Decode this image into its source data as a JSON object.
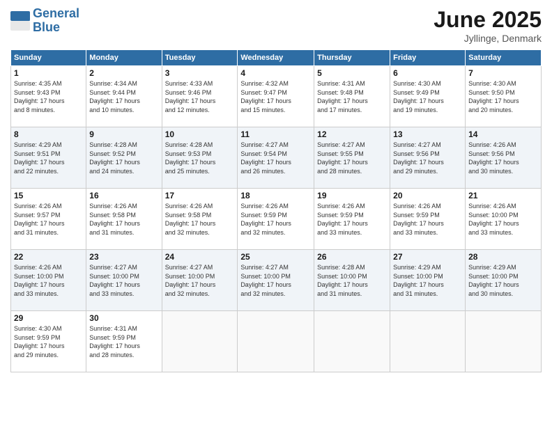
{
  "logo": {
    "line1": "General",
    "line2": "Blue"
  },
  "title": "June 2025",
  "subtitle": "Jyllinge, Denmark",
  "days_of_week": [
    "Sunday",
    "Monday",
    "Tuesday",
    "Wednesday",
    "Thursday",
    "Friday",
    "Saturday"
  ],
  "weeks": [
    [
      {
        "day": "1",
        "info": "Sunrise: 4:35 AM\nSunset: 9:43 PM\nDaylight: 17 hours\nand 8 minutes."
      },
      {
        "day": "2",
        "info": "Sunrise: 4:34 AM\nSunset: 9:44 PM\nDaylight: 17 hours\nand 10 minutes."
      },
      {
        "day": "3",
        "info": "Sunrise: 4:33 AM\nSunset: 9:46 PM\nDaylight: 17 hours\nand 12 minutes."
      },
      {
        "day": "4",
        "info": "Sunrise: 4:32 AM\nSunset: 9:47 PM\nDaylight: 17 hours\nand 15 minutes."
      },
      {
        "day": "5",
        "info": "Sunrise: 4:31 AM\nSunset: 9:48 PM\nDaylight: 17 hours\nand 17 minutes."
      },
      {
        "day": "6",
        "info": "Sunrise: 4:30 AM\nSunset: 9:49 PM\nDaylight: 17 hours\nand 19 minutes."
      },
      {
        "day": "7",
        "info": "Sunrise: 4:30 AM\nSunset: 9:50 PM\nDaylight: 17 hours\nand 20 minutes."
      }
    ],
    [
      {
        "day": "8",
        "info": "Sunrise: 4:29 AM\nSunset: 9:51 PM\nDaylight: 17 hours\nand 22 minutes."
      },
      {
        "day": "9",
        "info": "Sunrise: 4:28 AM\nSunset: 9:52 PM\nDaylight: 17 hours\nand 24 minutes."
      },
      {
        "day": "10",
        "info": "Sunrise: 4:28 AM\nSunset: 9:53 PM\nDaylight: 17 hours\nand 25 minutes."
      },
      {
        "day": "11",
        "info": "Sunrise: 4:27 AM\nSunset: 9:54 PM\nDaylight: 17 hours\nand 26 minutes."
      },
      {
        "day": "12",
        "info": "Sunrise: 4:27 AM\nSunset: 9:55 PM\nDaylight: 17 hours\nand 28 minutes."
      },
      {
        "day": "13",
        "info": "Sunrise: 4:27 AM\nSunset: 9:56 PM\nDaylight: 17 hours\nand 29 minutes."
      },
      {
        "day": "14",
        "info": "Sunrise: 4:26 AM\nSunset: 9:56 PM\nDaylight: 17 hours\nand 30 minutes."
      }
    ],
    [
      {
        "day": "15",
        "info": "Sunrise: 4:26 AM\nSunset: 9:57 PM\nDaylight: 17 hours\nand 31 minutes."
      },
      {
        "day": "16",
        "info": "Sunrise: 4:26 AM\nSunset: 9:58 PM\nDaylight: 17 hours\nand 31 minutes."
      },
      {
        "day": "17",
        "info": "Sunrise: 4:26 AM\nSunset: 9:58 PM\nDaylight: 17 hours\nand 32 minutes."
      },
      {
        "day": "18",
        "info": "Sunrise: 4:26 AM\nSunset: 9:59 PM\nDaylight: 17 hours\nand 32 minutes."
      },
      {
        "day": "19",
        "info": "Sunrise: 4:26 AM\nSunset: 9:59 PM\nDaylight: 17 hours\nand 33 minutes."
      },
      {
        "day": "20",
        "info": "Sunrise: 4:26 AM\nSunset: 9:59 PM\nDaylight: 17 hours\nand 33 minutes."
      },
      {
        "day": "21",
        "info": "Sunrise: 4:26 AM\nSunset: 10:00 PM\nDaylight: 17 hours\nand 33 minutes."
      }
    ],
    [
      {
        "day": "22",
        "info": "Sunrise: 4:26 AM\nSunset: 10:00 PM\nDaylight: 17 hours\nand 33 minutes."
      },
      {
        "day": "23",
        "info": "Sunrise: 4:27 AM\nSunset: 10:00 PM\nDaylight: 17 hours\nand 33 minutes."
      },
      {
        "day": "24",
        "info": "Sunrise: 4:27 AM\nSunset: 10:00 PM\nDaylight: 17 hours\nand 32 minutes."
      },
      {
        "day": "25",
        "info": "Sunrise: 4:27 AM\nSunset: 10:00 PM\nDaylight: 17 hours\nand 32 minutes."
      },
      {
        "day": "26",
        "info": "Sunrise: 4:28 AM\nSunset: 10:00 PM\nDaylight: 17 hours\nand 31 minutes."
      },
      {
        "day": "27",
        "info": "Sunrise: 4:29 AM\nSunset: 10:00 PM\nDaylight: 17 hours\nand 31 minutes."
      },
      {
        "day": "28",
        "info": "Sunrise: 4:29 AM\nSunset: 10:00 PM\nDaylight: 17 hours\nand 30 minutes."
      }
    ],
    [
      {
        "day": "29",
        "info": "Sunrise: 4:30 AM\nSunset: 9:59 PM\nDaylight: 17 hours\nand 29 minutes."
      },
      {
        "day": "30",
        "info": "Sunrise: 4:31 AM\nSunset: 9:59 PM\nDaylight: 17 hours\nand 28 minutes."
      },
      {
        "day": "",
        "info": ""
      },
      {
        "day": "",
        "info": ""
      },
      {
        "day": "",
        "info": ""
      },
      {
        "day": "",
        "info": ""
      },
      {
        "day": "",
        "info": ""
      }
    ]
  ]
}
